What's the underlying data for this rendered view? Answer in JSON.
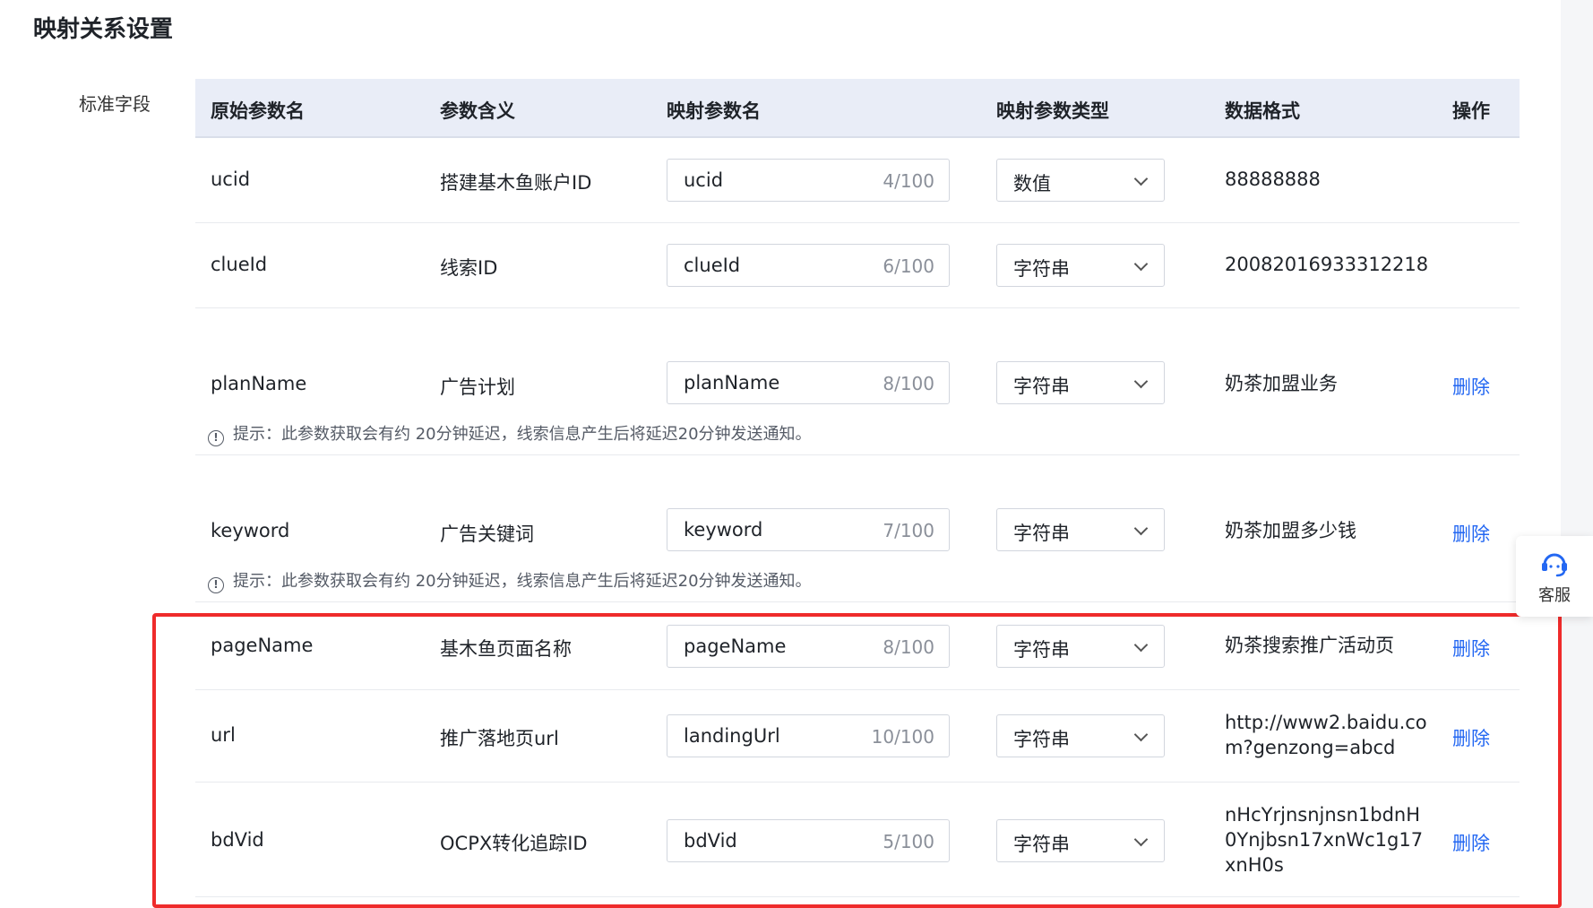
{
  "page": {
    "title": "映射关系设置",
    "section_label": "标准字段"
  },
  "table": {
    "columns": [
      "原始参数名",
      "参数含义",
      "映射参数名",
      "映射参数类型",
      "数据格式",
      "操作"
    ],
    "hint_text": "提示：此参数获取会有约 20分钟延迟，线索信息产生后将延迟20分钟发送通知。",
    "delete_label": "删除",
    "rows": [
      {
        "param": "ucid",
        "meaning": "搭建基木鱼账户ID",
        "mapped": "ucid",
        "count": "4/100",
        "type": "数值",
        "format": "88888888"
      },
      {
        "param": "clueId",
        "meaning": "线索ID",
        "mapped": "clueId",
        "count": "6/100",
        "type": "字符串",
        "format": "20082016933312218"
      },
      {
        "param": "planName",
        "meaning": "广告计划",
        "mapped": "planName",
        "count": "8/100",
        "type": "字符串",
        "format": "奶茶加盟业务"
      },
      {
        "param": "keyword",
        "meaning": "广告关键词",
        "mapped": "keyword",
        "count": "7/100",
        "type": "字符串",
        "format": "奶茶加盟多少钱"
      },
      {
        "param": "pageName",
        "meaning": "基木鱼页面名称",
        "mapped": "pageName",
        "count": "8/100",
        "type": "字符串",
        "format": "奶茶搜索推广活动页"
      },
      {
        "param": "url",
        "meaning": "推广落地页url",
        "mapped": "landingUrl",
        "count": "10/100",
        "type": "字符串",
        "format": "http://www2.baidu.com?genzong=abcd"
      },
      {
        "param": "bdVid",
        "meaning": "OCPX转化追踪ID",
        "mapped": "bdVid",
        "count": "5/100",
        "type": "字符串",
        "format": "nHcYrjnsnjnsn1bdnH0Ynjbsn17xnWc1g17xnH0s"
      }
    ]
  },
  "service": {
    "label": "客服",
    "icon": "headset-icon"
  },
  "colors": {
    "link": "#2468f2",
    "header_bg": "#e9edf7",
    "highlight": "#ef2b2b"
  }
}
